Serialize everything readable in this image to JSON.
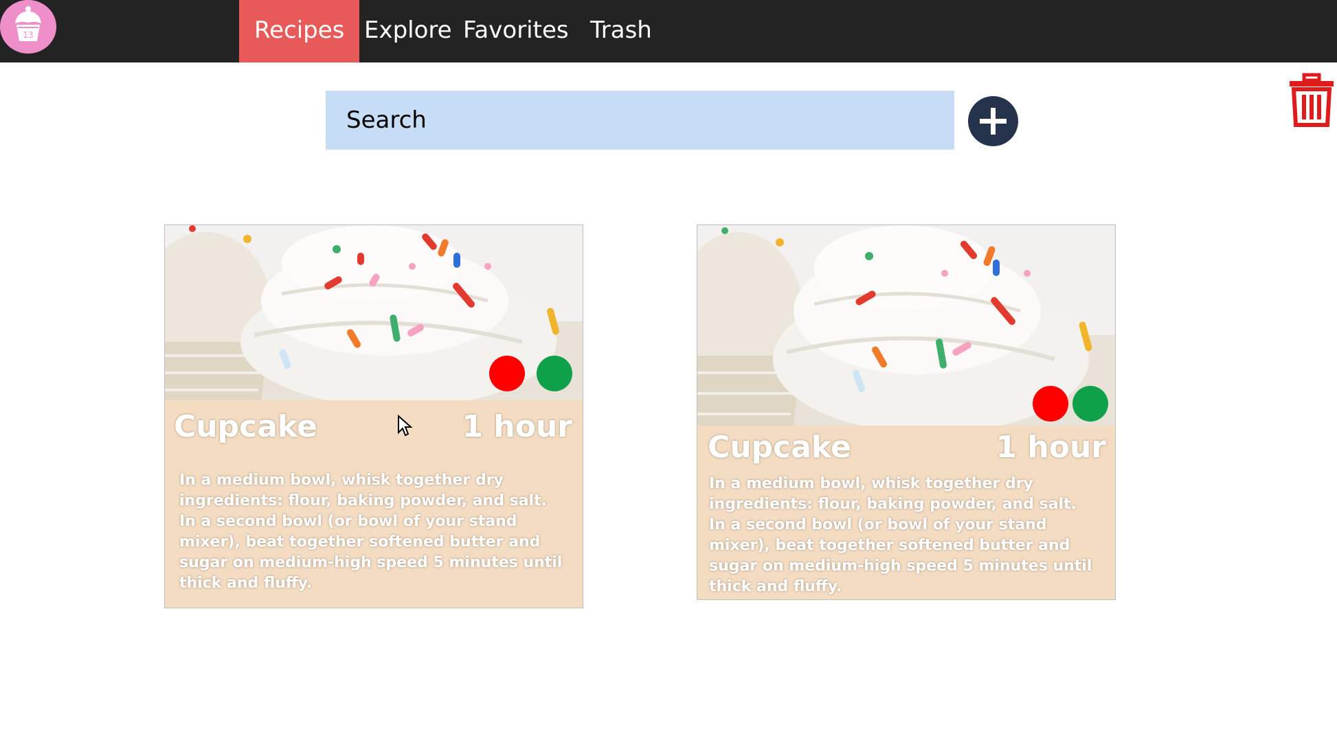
{
  "nav": {
    "items": [
      {
        "label": "Recipes",
        "active": true
      },
      {
        "label": "Explore",
        "active": false
      },
      {
        "label": "Favorites",
        "active": false
      },
      {
        "label": "Trash",
        "active": false
      }
    ],
    "logo_icon": "cupcake-logo",
    "logo_text": "13"
  },
  "search": {
    "placeholder": "Search"
  },
  "actions": {
    "add_icon": "plus-icon",
    "trash_icon": "trash-icon"
  },
  "colors": {
    "navbar": "#232323",
    "active_tab": "#e85a5a",
    "search_bg": "#c7ddf5",
    "add_button": "#26334d",
    "trash": "#e01b1b",
    "card_bg": "#f3dcc2",
    "red_dot": "#ff0000",
    "green_dot": "#0fa14a"
  },
  "cards": [
    {
      "title": "Cupcake",
      "time": "1 hour",
      "desc_lines": [
        "In a medium bowl, whisk together dry",
        "ingredients: flour, baking powder, and salt.",
        "In a second bowl (or bowl of your stand",
        "mixer), beat together softened butter and",
        "sugar on medium-high speed 5 minutes until",
        "thick and fluffy."
      ]
    },
    {
      "title": "Cupcake",
      "time": "1 hour",
      "desc_lines": [
        "In a medium bowl, whisk together dry",
        "ingredients: flour, baking powder, and salt.",
        "In a second bowl (or bowl of your stand",
        "mixer), beat together softened butter and",
        "sugar on medium-high speed 5 minutes until",
        "thick and fluffy."
      ]
    }
  ]
}
